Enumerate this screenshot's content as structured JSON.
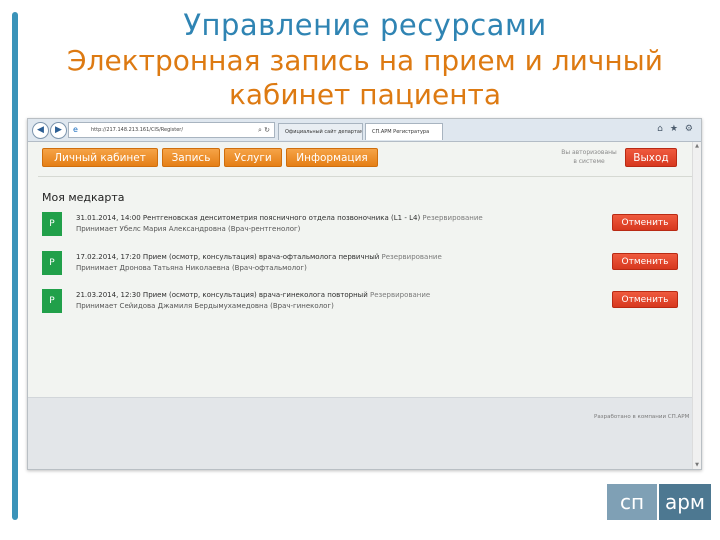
{
  "slide": {
    "title": "Управление ресурсами",
    "subtitle_line1": "Электронная запись на прием и личный",
    "subtitle_line2": "кабинет пациента",
    "logo_left": "сп",
    "logo_right": "арм"
  },
  "browser": {
    "url": "http://217.148.213.161/CIS/Register/",
    "tabs": [
      {
        "label": "Официальный сайт департам...",
        "active": false
      },
      {
        "label": "СП.АРМ Регистратура",
        "active": true
      }
    ],
    "icons": [
      "back-icon",
      "forward-icon",
      "search-icon",
      "refresh-icon",
      "home-icon",
      "star-icon",
      "gear-icon"
    ]
  },
  "app": {
    "menu": [
      "Личный кабинет",
      "Запись",
      "Услуги",
      "Информация"
    ],
    "login_status_line1": "Вы авторизованы",
    "login_status_line2": "в системе",
    "exit_label": "Выход",
    "section_title": "Моя медкарта",
    "records": [
      {
        "status": "Р",
        "title": "31.01.2014, 14:00 Рентгеновская денситометрия поясничного отдела позвоночника (L1 - L4)",
        "state": "Резервирование",
        "doctor": "Принимает Убелс Мария Александровна (Врач-рентгенолог)",
        "action": "Отменить"
      },
      {
        "status": "Р",
        "title": "17.02.2014, 17:20 Прием (осмотр, консультация) врача-офтальмолога первичный",
        "state": "Резервирование",
        "doctor": "Принимает Дронова Татьяна Николаевна (Врач-офтальмолог)",
        "action": "Отменить"
      },
      {
        "status": "Р",
        "title": "21.03.2014, 12:30 Прием (осмотр, консультация) врача-гинеколога повторный",
        "state": "Резервирование",
        "doctor": "Принимает Сейидова Джамиля Бердымухамедовна (Врач-гинеколог)",
        "action": "Отменить"
      }
    ],
    "footer_note": "Разработано в компании СП.АРМ"
  },
  "colors": {
    "accent_blue": "#2f84b3",
    "accent_orange": "#dd7a12",
    "menu_orange": "#f0922c",
    "danger_red": "#e04a2f",
    "status_green": "#21a04a"
  }
}
